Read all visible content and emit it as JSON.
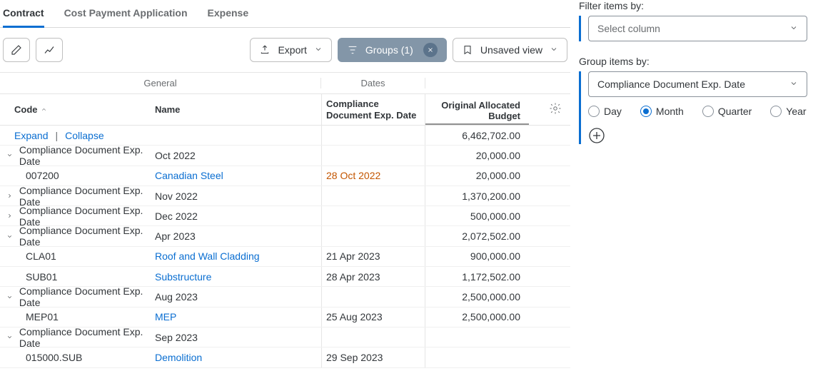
{
  "tabs": [
    {
      "label": "Contract",
      "active": true
    },
    {
      "label": "Cost Payment Application",
      "active": false
    },
    {
      "label": "Expense",
      "active": false
    }
  ],
  "toolbar": {
    "export_label": "Export",
    "groups_label": "Groups (1)",
    "unsaved_label": "Unsaved view"
  },
  "columns": {
    "super_general": "General",
    "super_dates": "Dates",
    "code": "Code",
    "name": "Name",
    "date": "Compliance Document Exp. Date",
    "budget": "Original Allocated Budget"
  },
  "expand": "Expand",
  "collapse": "Collapse",
  "total_budget": "6,462,702.00",
  "group_field_label": "Compliance Document Exp. Date",
  "rows": [
    {
      "type": "group",
      "collapsed": false,
      "month": "Oct 2022",
      "budget": "20,000.00"
    },
    {
      "type": "item",
      "code": "007200",
      "name": "Canadian Steel",
      "date": "28 Oct 2022",
      "warn": true,
      "budget": "20,000.00"
    },
    {
      "type": "group",
      "collapsed": true,
      "month": "Nov 2022",
      "budget": "1,370,200.00"
    },
    {
      "type": "group",
      "collapsed": true,
      "month": "Dec 2022",
      "budget": "500,000.00"
    },
    {
      "type": "group",
      "collapsed": false,
      "month": "Apr 2023",
      "budget": "2,072,502.00"
    },
    {
      "type": "item",
      "code": "CLA01",
      "name": "Roof and Wall Cladding",
      "date": "21 Apr 2023",
      "budget": "900,000.00"
    },
    {
      "type": "item",
      "code": "SUB01",
      "name": "Substructure",
      "date": "28 Apr 2023",
      "budget": "1,172,502.00"
    },
    {
      "type": "group",
      "collapsed": false,
      "month": "Aug 2023",
      "budget": "2,500,000.00"
    },
    {
      "type": "item",
      "code": "MEP01",
      "name": "MEP",
      "date": "25 Aug 2023",
      "budget": "2,500,000.00"
    },
    {
      "type": "group",
      "collapsed": false,
      "month": "Sep 2023",
      "budget": ""
    },
    {
      "type": "item",
      "code": "015000.SUB",
      "name": "Demolition",
      "date": "29 Sep 2023",
      "budget": ""
    }
  ],
  "side": {
    "filter_label": "Filter items by:",
    "filter_placeholder": "Select column",
    "group_label": "Group items by:",
    "group_value": "Compliance Document Exp. Date",
    "radios": [
      "Day",
      "Month",
      "Quarter",
      "Year"
    ],
    "radio_active": "Month"
  }
}
